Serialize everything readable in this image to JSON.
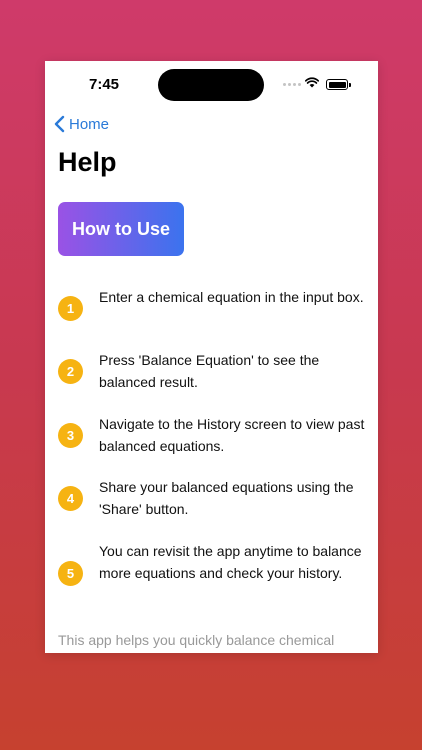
{
  "status_bar": {
    "time": "7:45"
  },
  "nav": {
    "back_label": "Home"
  },
  "page": {
    "title": "Help"
  },
  "section": {
    "header": "How to Use"
  },
  "steps": [
    {
      "number": "1",
      "text": "Enter a chemical equation in the input box."
    },
    {
      "number": "2",
      "text": "Press 'Balance Equation' to see the balanced result."
    },
    {
      "number": "3",
      "text": "Navigate to the History screen to view past balanced equations."
    },
    {
      "number": "4",
      "text": "Share your balanced equations using the 'Share' button."
    },
    {
      "number": "5",
      "text": "You can revisit the app anytime to balance more equations and check your history."
    }
  ],
  "footer": {
    "text": "This app helps you quickly balance chemical"
  },
  "colors": {
    "accent": "#2a7ad8",
    "step_badge": "#f6b312",
    "gradient_start": "#9a52e5",
    "gradient_end": "#3b73ee"
  }
}
